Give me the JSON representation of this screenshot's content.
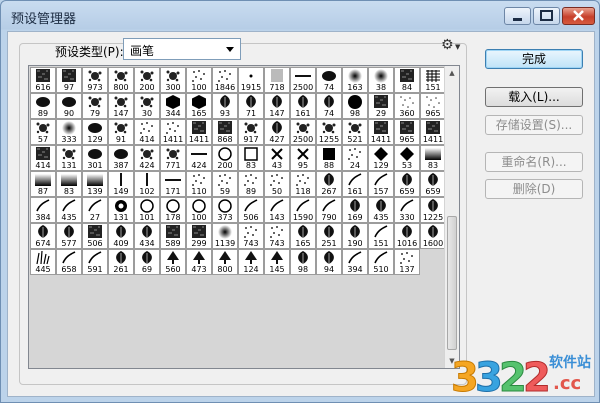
{
  "window": {
    "title": "预设管理器"
  },
  "preset_type": {
    "label": "预设类型(P):",
    "value": "画笔"
  },
  "buttons": {
    "done": "完成",
    "load": "载入(L)...",
    "save_set": "存储设置(S)...",
    "rename": "重命名(R)...",
    "delete": "删除(D)"
  },
  "brushes": [
    {
      "n": "616",
      "s": "tex"
    },
    {
      "n": "97",
      "s": "tex"
    },
    {
      "n": "973",
      "s": "spat"
    },
    {
      "n": "800",
      "s": "spat"
    },
    {
      "n": "200",
      "s": "spat"
    },
    {
      "n": "300",
      "s": "spat"
    },
    {
      "n": "100",
      "s": "dots"
    },
    {
      "n": "1846",
      "s": "dots"
    },
    {
      "n": "1915",
      "s": "dot"
    },
    {
      "n": "718",
      "s": "tex-light"
    },
    {
      "n": "2500",
      "s": "line"
    },
    {
      "n": "74",
      "s": "blob"
    },
    {
      "n": "163",
      "s": "soft"
    },
    {
      "n": "38",
      "s": "soft"
    },
    {
      "n": "84",
      "s": "tex"
    },
    {
      "n": "151",
      "s": "grid"
    },
    {
      "n": "89",
      "s": "blob"
    },
    {
      "n": "90",
      "s": "blob"
    },
    {
      "n": "79",
      "s": "spat"
    },
    {
      "n": "147",
      "s": "spat"
    },
    {
      "n": "30",
      "s": "spat"
    },
    {
      "n": "344",
      "s": "hex"
    },
    {
      "n": "165",
      "s": "hex"
    },
    {
      "n": "93",
      "s": "leaf"
    },
    {
      "n": "71",
      "s": "leaf"
    },
    {
      "n": "147",
      "s": "leaf"
    },
    {
      "n": "161",
      "s": "leaf"
    },
    {
      "n": "74",
      "s": "leaf"
    },
    {
      "n": "98",
      "s": "circle"
    },
    {
      "n": "29",
      "s": "tex"
    },
    {
      "n": "360",
      "s": "scatter"
    },
    {
      "n": "965",
      "s": "scatter"
    },
    {
      "n": "57",
      "s": "spat"
    },
    {
      "n": "333",
      "s": "soft"
    },
    {
      "n": "129",
      "s": "blob"
    },
    {
      "n": "91",
      "s": "spat"
    },
    {
      "n": "414",
      "s": "dots"
    },
    {
      "n": "1411",
      "s": "dots"
    },
    {
      "n": "1411",
      "s": "tex"
    },
    {
      "n": "868",
      "s": "tex"
    },
    {
      "n": "917",
      "s": "spat"
    },
    {
      "n": "427",
      "s": "leaf"
    },
    {
      "n": "2500",
      "s": "spat"
    },
    {
      "n": "1255",
      "s": "spat"
    },
    {
      "n": "521",
      "s": "spat"
    },
    {
      "n": "1411",
      "s": "tex"
    },
    {
      "n": "965",
      "s": "tex"
    },
    {
      "n": "1411",
      "s": "tex"
    },
    {
      "n": "414",
      "s": "tex"
    },
    {
      "n": "131",
      "s": "spat"
    },
    {
      "n": "301",
      "s": "blob"
    },
    {
      "n": "387",
      "s": "blob"
    },
    {
      "n": "424",
      "s": "spat"
    },
    {
      "n": "771",
      "s": "spat"
    },
    {
      "n": "424",
      "s": "line"
    },
    {
      "n": "200",
      "s": "ring"
    },
    {
      "n": "83",
      "s": "square-o"
    },
    {
      "n": "43",
      "s": "x"
    },
    {
      "n": "95",
      "s": "x"
    },
    {
      "n": "88",
      "s": "square"
    },
    {
      "n": "24",
      "s": "dots"
    },
    {
      "n": "129",
      "s": "diamond"
    },
    {
      "n": "53",
      "s": "diamond"
    },
    {
      "n": "83",
      "s": "grad"
    },
    {
      "n": "87",
      "s": "grad"
    },
    {
      "n": "83",
      "s": "grad"
    },
    {
      "n": "139",
      "s": "grad"
    },
    {
      "n": "149",
      "s": "vline"
    },
    {
      "n": "102",
      "s": "vline"
    },
    {
      "n": "171",
      "s": "line"
    },
    {
      "n": "110",
      "s": "dots"
    },
    {
      "n": "59",
      "s": "dots"
    },
    {
      "n": "89",
      "s": "dots"
    },
    {
      "n": "50",
      "s": "dots"
    },
    {
      "n": "118",
      "s": "dots"
    },
    {
      "n": "267",
      "s": "leaf"
    },
    {
      "n": "161",
      "s": "stroke"
    },
    {
      "n": "157",
      "s": "stroke"
    },
    {
      "n": "659",
      "s": "leaf"
    },
    {
      "n": "659",
      "s": "leaf"
    },
    {
      "n": "384",
      "s": "stroke"
    },
    {
      "n": "435",
      "s": "stroke"
    },
    {
      "n": "27",
      "s": "stroke"
    },
    {
      "n": "131",
      "s": "ring-thick"
    },
    {
      "n": "101",
      "s": "ring"
    },
    {
      "n": "178",
      "s": "ring"
    },
    {
      "n": "100",
      "s": "ring"
    },
    {
      "n": "373",
      "s": "ring"
    },
    {
      "n": "506",
      "s": "stroke"
    },
    {
      "n": "143",
      "s": "stroke"
    },
    {
      "n": "1590",
      "s": "stroke"
    },
    {
      "n": "790",
      "s": "stroke"
    },
    {
      "n": "169",
      "s": "leaf"
    },
    {
      "n": "435",
      "s": "leaf"
    },
    {
      "n": "330",
      "s": "stroke"
    },
    {
      "n": "1225",
      "s": "leaf"
    },
    {
      "n": "674",
      "s": "leaf"
    },
    {
      "n": "577",
      "s": "leaf"
    },
    {
      "n": "506",
      "s": "tex"
    },
    {
      "n": "409",
      "s": "leaf"
    },
    {
      "n": "434",
      "s": "leaf"
    },
    {
      "n": "589",
      "s": "tex"
    },
    {
      "n": "299",
      "s": "tex"
    },
    {
      "n": "1139",
      "s": "soft"
    },
    {
      "n": "743",
      "s": "dots"
    },
    {
      "n": "743",
      "s": "dots"
    },
    {
      "n": "165",
      "s": "leaf"
    },
    {
      "n": "251",
      "s": "leaf"
    },
    {
      "n": "190",
      "s": "leaf"
    },
    {
      "n": "151",
      "s": "stroke"
    },
    {
      "n": "1016",
      "s": "leaf"
    },
    {
      "n": "1600",
      "s": "leaf"
    },
    {
      "n": "445",
      "s": "grass"
    },
    {
      "n": "658",
      "s": "stroke"
    },
    {
      "n": "591",
      "s": "stroke"
    },
    {
      "n": "261",
      "s": "leaf"
    },
    {
      "n": "69",
      "s": "leaf"
    },
    {
      "n": "560",
      "s": "tree"
    },
    {
      "n": "473",
      "s": "tree"
    },
    {
      "n": "800",
      "s": "tree"
    },
    {
      "n": "124",
      "s": "tree"
    },
    {
      "n": "145",
      "s": "tree"
    },
    {
      "n": "98",
      "s": "leaf"
    },
    {
      "n": "94",
      "s": "leaf"
    },
    {
      "n": "394",
      "s": "stroke"
    },
    {
      "n": "510",
      "s": "stroke"
    },
    {
      "n": "137",
      "s": "dots"
    }
  ]
}
